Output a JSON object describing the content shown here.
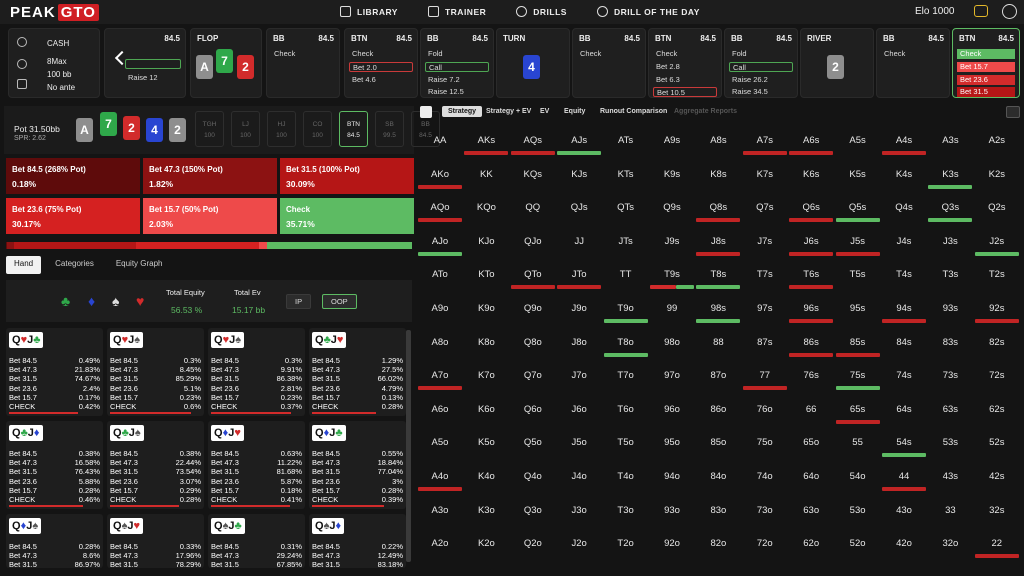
{
  "app": {
    "logo_a": "PEAK",
    "logo_b": "GTO",
    "elo": "Elo 1000"
  },
  "nav": [
    {
      "label": "LIBRARY",
      "icon": "library-icon"
    },
    {
      "label": "TRAINER",
      "icon": "gamepad-icon"
    },
    {
      "label": "DRILLS",
      "icon": "globe-icon"
    },
    {
      "label": "DRILL OF THE DAY",
      "icon": "plus-circle-icon"
    }
  ],
  "game_info": {
    "type": "CASH",
    "format": "8Max",
    "stack": "100 bb",
    "ante": "No ante"
  },
  "nodes": {
    "n0": {
      "stack": "84.5",
      "a1": "Raise 12"
    },
    "flop": {
      "title": "FLOP",
      "cards": [
        "A",
        "7",
        "2"
      ]
    },
    "bb1": {
      "pos": "BB",
      "stack": "84.5",
      "a1": "Check"
    },
    "btn1": {
      "pos": "BTN",
      "stack": "84.5",
      "a1": "Check",
      "a2": "Bet 2.0",
      "a3": "Bet 4.6"
    },
    "bb2": {
      "pos": "BB",
      "stack": "84.5",
      "a1": "Fold",
      "a2": "Call",
      "a3": "Raise 7.2",
      "a4": "Raise 12.5"
    },
    "turn": {
      "title": "TURN",
      "card": "4"
    },
    "bb3": {
      "pos": "BB",
      "stack": "84.5",
      "a1": "Check"
    },
    "btn2": {
      "pos": "BTN",
      "stack": "84.5",
      "a1": "Check",
      "a2": "Bet 2.8",
      "a3": "Bet 6.3",
      "a4": "Bet 10.5"
    },
    "bb4": {
      "pos": "BB",
      "stack": "84.5",
      "a1": "Fold",
      "a2": "Call",
      "a3": "Raise 26.2",
      "a4": "Raise 34.5"
    },
    "river": {
      "title": "RIVER",
      "card": "2"
    },
    "bb5": {
      "pos": "BB",
      "stack": "84.5",
      "a1": "Check"
    },
    "btn3": {
      "pos": "BTN",
      "stack": "84.5",
      "a1": "Check",
      "a2": "Bet 15.7",
      "a3": "Bet 23.6",
      "a4": "Bet 31.5"
    }
  },
  "pot": {
    "label": "Pot  31.50bb",
    "spr": "SPR: 2.62",
    "board": [
      "A",
      "7",
      "2",
      "4",
      "2"
    ]
  },
  "seats": [
    {
      "pos": "TGH",
      "stk": "100"
    },
    {
      "pos": "LJ",
      "stk": "100"
    },
    {
      "pos": "HJ",
      "stk": "100"
    },
    {
      "pos": "CO",
      "stk": "100"
    },
    {
      "pos": "BTN",
      "stk": "84.5"
    },
    {
      "pos": "SB",
      "stk": "99.5"
    },
    {
      "pos": "BB",
      "stk": "84.5"
    }
  ],
  "actions": [
    {
      "label": "Bet 84.5 (268% Pot)",
      "pct": "0.18%",
      "color": "#5e0b0b"
    },
    {
      "label": "Bet 47.3 (150% Pot)",
      "pct": "1.82%",
      "color": "#8c1212"
    },
    {
      "label": "Bet 31.5 (100% Pot)",
      "pct": "30.09%",
      "color": "#b51616"
    },
    {
      "label": "Bet 23.6 (75% Pot)",
      "pct": "30.17%",
      "color": "#d52121"
    },
    {
      "label": "Bet 15.7 (50% Pot)",
      "pct": "2.03%",
      "color": "#ee4a4a"
    },
    {
      "label": "Check",
      "pct": "35.71%",
      "color": "#5dbb63"
    }
  ],
  "tabs": [
    "Hand",
    "Categories",
    "Equity Graph"
  ],
  "equity": {
    "total_equity_label": "Total Equity",
    "total_equity": "56.53 %",
    "total_ev_label": "Total Ev",
    "total_ev": "15.17 bb",
    "ip": "IP",
    "oop": "OOP"
  },
  "row_labels": [
    "Bet 84.5",
    "Bet 47.3",
    "Bet 31.5",
    "Bet 23.6",
    "Bet 15.7",
    "CHECK"
  ],
  "combos": [
    {
      "r1": "Q",
      "s1": "♥",
      "r2": "J",
      "s2": "♣",
      "c1": "#d22b2b",
      "c2": "#2fa84a",
      "v": [
        "0.49%",
        "21.83%",
        "74.67%",
        "2.4%",
        "0.17%",
        "0.42%"
      ]
    },
    {
      "r1": "Q",
      "s1": "♥",
      "r2": "J",
      "s2": "♠",
      "c1": "#d22b2b",
      "c2": "#555",
      "v": [
        "0.3%",
        "8.45%",
        "85.29%",
        "5.1%",
        "0.23%",
        "0.6%"
      ]
    },
    {
      "r1": "Q",
      "s1": "♥",
      "r2": "J",
      "s2": "♠",
      "c1": "#d22b2b",
      "c2": "#555",
      "v": [
        "0.3%",
        "9.91%",
        "86.38%",
        "2.81%",
        "0.23%",
        "0.37%"
      ]
    },
    {
      "r1": "Q",
      "s1": "♣",
      "r2": "J",
      "s2": "♥",
      "c1": "#2fa84a",
      "c2": "#d22b2b",
      "v": [
        "1.29%",
        "27.5%",
        "66.02%",
        "4.79%",
        "0.13%",
        "0.28%"
      ]
    },
    {
      "r1": "Q",
      "s1": "♣",
      "r2": "J",
      "s2": "♦",
      "c1": "#2fa84a",
      "c2": "#2945d1",
      "v": [
        "0.38%",
        "16.58%",
        "76.43%",
        "5.88%",
        "0.28%",
        "0.46%"
      ]
    },
    {
      "r1": "Q",
      "s1": "♣",
      "r2": "J",
      "s2": "♠",
      "c1": "#2fa84a",
      "c2": "#555",
      "v": [
        "0.38%",
        "22.44%",
        "73.54%",
        "3.07%",
        "0.29%",
        "0.28%"
      ]
    },
    {
      "r1": "Q",
      "s1": "♦",
      "r2": "J",
      "s2": "♥",
      "c1": "#2945d1",
      "c2": "#d22b2b",
      "v": [
        "0.63%",
        "11.22%",
        "81.68%",
        "5.87%",
        "0.18%",
        "0.41%"
      ]
    },
    {
      "r1": "Q",
      "s1": "♦",
      "r2": "J",
      "s2": "♣",
      "c1": "#2945d1",
      "c2": "#2fa84a",
      "v": [
        "0.55%",
        "18.84%",
        "77.04%",
        "3%",
        "0.28%",
        "0.39%"
      ]
    },
    {
      "r1": "Q",
      "s1": "♦",
      "r2": "J",
      "s2": "♠",
      "c1": "#2945d1",
      "c2": "#555",
      "v": [
        "0.28%",
        "8.6%",
        "86.97%"
      ]
    },
    {
      "r1": "Q",
      "s1": "♠",
      "r2": "J",
      "s2": "♥",
      "c1": "#555",
      "c2": "#d22b2b",
      "v": [
        "0.33%",
        "17.96%",
        "78.29%"
      ]
    },
    {
      "r1": "Q",
      "s1": "♠",
      "r2": "J",
      "s2": "♣",
      "c1": "#555",
      "c2": "#2fa84a",
      "v": [
        "0.31%",
        "29.24%",
        "67.85%"
      ]
    },
    {
      "r1": "Q",
      "s1": "♠",
      "r2": "J",
      "s2": "♦",
      "c1": "#555",
      "c2": "#2945d1",
      "v": [
        "0.22%",
        "12.49%",
        "83.18%"
      ]
    }
  ],
  "right_tabs": [
    "Strategy",
    "Strategy + EV",
    "EV",
    "Equity",
    "Runout Comparison",
    "Aggregate Reports"
  ],
  "ranks": [
    "A",
    "K",
    "Q",
    "J",
    "T",
    "9",
    "8",
    "7",
    "6",
    "5",
    "4",
    "3",
    "2"
  ],
  "marks": {
    "AKs": "r",
    "AQs": "r",
    "AJs": "g",
    "A7s": "r",
    "A6s": "r",
    "A4s": "r",
    "AKo": "r",
    "K3s": "g",
    "AQo": "r",
    "Q8s": "r",
    "Q6s": "r",
    "Q5s": "g",
    "Q3s": "g",
    "AJo": "g",
    "J8s": "r",
    "J6s": "r",
    "J5s": "r",
    "J2s": "g",
    "QTo": "r",
    "JTo": "r",
    "T9s": "rg",
    "T8s": "g",
    "T6s": "r",
    "T9o": "g",
    "98s": "g",
    "96s": "r",
    "94s": "r",
    "92s": "r",
    "T8o": "g",
    "86s": "r",
    "85s": "r",
    "A7o": "r",
    "77": "r",
    "75s": "g",
    "65s": "r",
    "54s": "g",
    "A4o": "r",
    "44": "r",
    "22": "r"
  }
}
